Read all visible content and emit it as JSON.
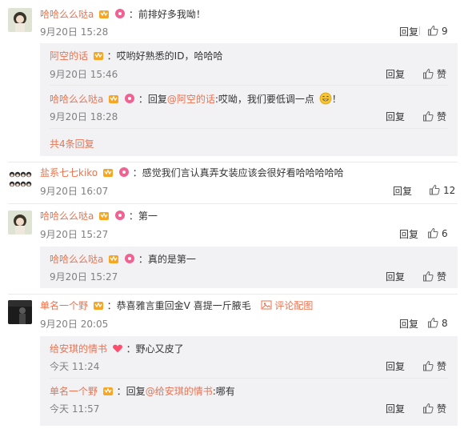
{
  "comments": [
    {
      "user": "哈哈么么哒a",
      "text": "：前排好多我呦！",
      "time": "9月20日 15:28",
      "reply_label": "回复",
      "likes": "9",
      "replies": [
        {
          "user": "阿空的话",
          "text": "：哎哟好熟悉的ID，哈哈哈",
          "time": "9月20日 15:46",
          "reply_label": "回复",
          "like_label": "赞"
        },
        {
          "user": "哈哈么么哒a",
          "text_prefix": "：回复",
          "mention": "@阿空的话",
          "text": ":哎呦，我们要低调一点",
          "text_suffix": "！",
          "time": "9月20日 18:28",
          "reply_label": "回复",
          "like_label": "赞"
        }
      ],
      "more": "共4条回复"
    },
    {
      "user": "盐系七七kiko",
      "text": "：感觉我们言认真弄女装应该会很好看哈哈哈哈哈",
      "time": "9月20日 16:07",
      "reply_label": "回复",
      "likes": "12"
    },
    {
      "user": "哈哈么么哒a",
      "text": "：第一",
      "time": "9月20日 15:27",
      "reply_label": "回复",
      "likes": "6",
      "replies": [
        {
          "user": "哈哈么么哒a",
          "text": "：真的是第一",
          "time": "9月20日 15:27",
          "reply_label": "回复",
          "like_label": "赞"
        }
      ]
    },
    {
      "user": "单名一个野",
      "text": "：恭喜雅言重回金V 喜提一斤腋毛",
      "pic_label": "评论配图",
      "time": "9月20日 20:05",
      "reply_label": "回复",
      "likes": "8",
      "replies": [
        {
          "user": "给安琪的情书",
          "text": "：野心又皮了",
          "time": "今天 11:24",
          "reply_label": "回复",
          "like_label": "赞"
        },
        {
          "user": "单名一个野",
          "text_prefix": "：回复",
          "mention": "@给安琪的情书",
          "text": ":哪有",
          "time": "今天 11:57",
          "reply_label": "回复",
          "like_label": "赞"
        }
      ]
    }
  ],
  "colors": {
    "username": "#eb7350",
    "reply_bg": "#f2f2f5",
    "text": "#333333",
    "muted": "#808080"
  }
}
